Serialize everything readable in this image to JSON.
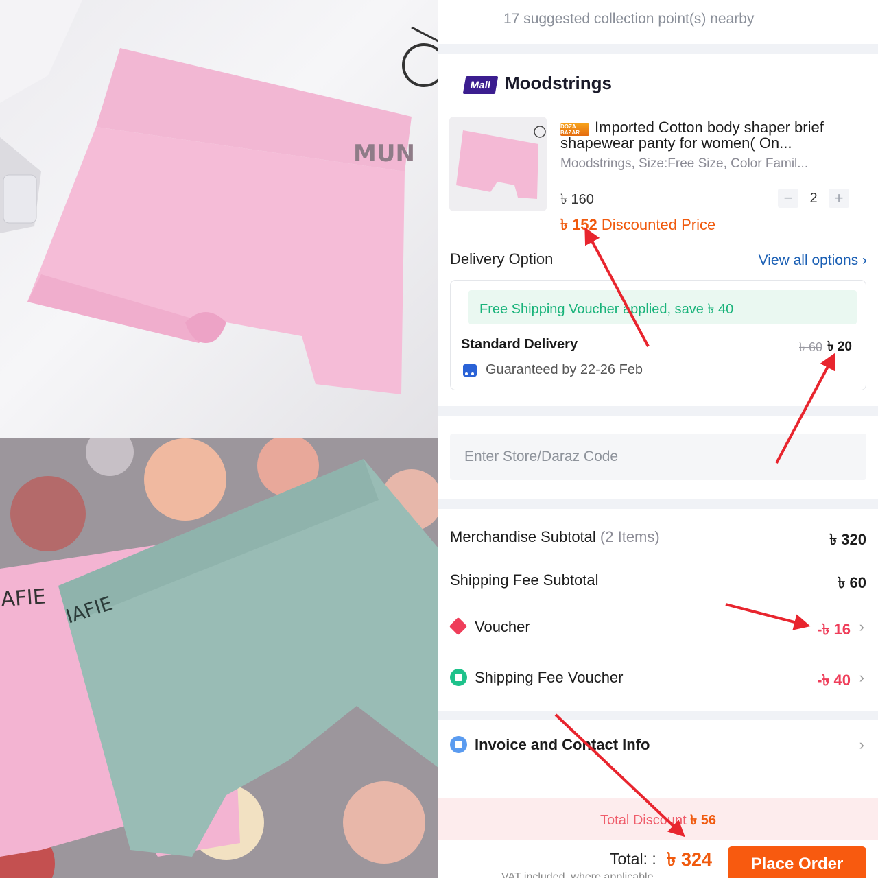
{
  "top_hint": "17 suggested collection point(s) nearby",
  "shop": {
    "mall_badge": "Mall",
    "name": "Moodstrings"
  },
  "product": {
    "badge": "DOZA BAZAR",
    "title": "Imported Cotton body shaper brief shapewear panty for women( On...",
    "variant": "Moodstrings, Size:Free Size, Color Famil...",
    "price": "৳ 160",
    "discounted_price": "৳ 152",
    "discounted_label": "Discounted Price",
    "quantity": "2",
    "qty_minus": "−",
    "qty_plus": "+"
  },
  "photo_text": {
    "top_logo": "MUN",
    "bottom_logo_left": "AFIE",
    "bottom_logo_right": "IAFIE"
  },
  "delivery": {
    "title": "Delivery Option",
    "view_all": "View all options ›",
    "free_shipping": "Free Shipping Voucher applied, save ৳ 40",
    "standard_label": "Standard Delivery",
    "old_fee": "৳ 60",
    "new_fee": "৳ 20",
    "guarantee": "Guaranteed by 22-26 Feb"
  },
  "code_input": {
    "placeholder": "Enter Store/Daraz Code"
  },
  "summary": {
    "merch_label": "Merchandise Subtotal",
    "merch_items": "(2 Items)",
    "merch_value": "৳ 320",
    "shipping_label": "Shipping Fee Subtotal",
    "shipping_value": "৳ 60",
    "voucher_label": "Voucher",
    "voucher_value": "-৳ 16",
    "ship_voucher_label": "Shipping Fee Voucher",
    "ship_voucher_value": "-৳ 40",
    "invoice_label": "Invoice and Contact Info",
    "chevron": "›"
  },
  "footer": {
    "total_discount_label": "Total Discount",
    "total_discount_value": "৳ 56",
    "total_label": "Total: :",
    "total_value": "৳ 324",
    "vat_text": "VAT included, where applicable",
    "place_order": "Place Order"
  },
  "colors": {
    "accent": "#f85a0f",
    "discount_red": "#ef3e5a",
    "link_blue": "#1a5fb4",
    "free_ship_green": "#19b37a",
    "mall_purple": "#3b1d8f"
  }
}
